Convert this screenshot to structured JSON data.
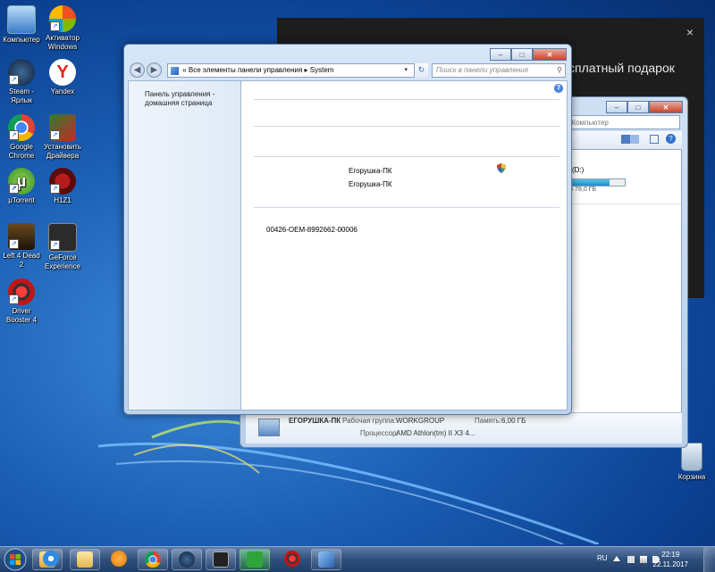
{
  "desktop": {
    "icons": [
      {
        "label": "Компьютер",
        "icon": "computer-icon"
      },
      {
        "label": "Активатор Windows",
        "icon": "activator-icon"
      },
      {
        "label": "Steam - Ярлык",
        "icon": "steam-icon"
      },
      {
        "label": "Yandex",
        "icon": "yandex-icon"
      },
      {
        "label": "Google Chrome",
        "icon": "chrome-icon"
      },
      {
        "label": "Установить Драйвера",
        "icon": "drivers-icon"
      },
      {
        "label": "µTorrent",
        "icon": "utorrent-icon"
      },
      {
        "label": "H1Z1",
        "icon": "h1z1-icon"
      },
      {
        "label": "Left 4 Dead 2",
        "icon": "left4dead-icon"
      },
      {
        "label": "GeForce Experience",
        "icon": "geforce-icon"
      },
      {
        "label": "Driver Booster 4",
        "icon": "driver-booster-icon"
      },
      {
        "label": "Корзина",
        "icon": "recycle-bin-icon"
      }
    ]
  },
  "ad_panel": {
    "text": "сплатный подарок",
    "close": "×"
  },
  "back_window": {
    "search_placeholder": "с: Компьютер",
    "drive_label": "(D:)",
    "drive_free": "з 78,0 ГБ",
    "drive_fill": 0.72,
    "computer_name": "ЕГОРУШКА-ПК",
    "workgroup_label": "Рабочая группа:",
    "workgroup": "WORKGROUP",
    "memory_label": "Память:",
    "memory": "6,00 ГБ",
    "cpu_label": "Процессор:",
    "cpu": "AMD Athlon(tm) II X3 4..."
  },
  "window": {
    "breadcrumb": [
      "Все элементы панели управления",
      "System"
    ],
    "search_placeholder": "Поиск в панели управления",
    "sidebar_link": "Панель управления - домашняя страница",
    "computer_name": "Егорушка-ПК",
    "full_name": "Егорушка-ПК",
    "product_id": "00426-OEM-8992662-00006",
    "help": "?",
    "minimize": "‒",
    "maximize": "□",
    "close": "✕"
  },
  "taskbar": {
    "lang": "RU",
    "time": "22:19",
    "date": "22.11.2017",
    "apps": [
      "explorer",
      "ie",
      "libraries",
      "media-player",
      "chrome",
      "steam",
      "geforce",
      "utorrent",
      "driver-booster",
      "control-panel"
    ]
  }
}
